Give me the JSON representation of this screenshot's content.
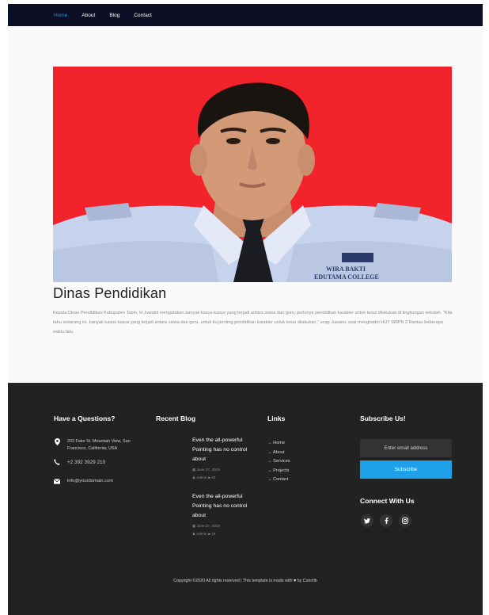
{
  "nav": {
    "items": [
      {
        "label": "Home",
        "active": true
      },
      {
        "label": "About"
      },
      {
        "label": "Blog"
      },
      {
        "label": "Contact"
      }
    ]
  },
  "article": {
    "title": "Dinas Pendidikan",
    "body": "Kepala Dinas Pendidikan Kabupaten Tapin, H Juwaini mengatakan banyak kasus-kasus yang terjadi antara siswa dan guru, perlunya pendidikan karakter untuk terus dilakukan di lingkungan sekolah. \"Kita tahu sekarang ini, banyak kasus-kasus yang terjadi antara siswa dan guru, untuk itu penting pendidikan karakter untuk terus dilakukan,\" ucap Juwaini, saat menghadiri HUT SMPN 2 Rantau beberapa waktu lalu.",
    "photo_badge_line1": "WIRA BAKTI",
    "photo_badge_line2": "EDUTAMA COLLEGE",
    "colors": {
      "photo_bg": "#f3232b",
      "shirt": "#c7d3ec",
      "tie": "#1a1c22"
    }
  },
  "footer": {
    "questions": {
      "heading": "Have a Questions?",
      "address": "203 Fake St. Mountain View, San Francisco, California, USA",
      "phone": "+2 392 3929 210",
      "email": "info@yourdomain.com"
    },
    "blog": {
      "heading": "Recent Blog",
      "posts": [
        {
          "title": "Even the all-powerful Pointing has no control about",
          "date": "June 27, 2019",
          "author": "Admin",
          "comments": "19"
        },
        {
          "title": "Even the all-powerful Pointing has no control about",
          "date": "June 27, 2019",
          "author": "Admin",
          "comments": "19"
        }
      ]
    },
    "links": {
      "heading": "Links",
      "items": [
        "→ Home",
        "→ About",
        "→ Services",
        "→ Projects",
        "→ Contact"
      ]
    },
    "subscribe": {
      "heading": "Subscribe Us!",
      "placeholder": "Enter email address",
      "button": "Subscribe",
      "connect_heading": "Connect With Us",
      "social_icons": [
        "twitter-icon",
        "facebook-icon",
        "instagram-icon"
      ]
    },
    "copyright": "Copyright ©2020 All rights reserved | This template is made with",
    "copyright_by": "by Colorlib"
  },
  "colors": {
    "nav_bg": "#0c0f23",
    "nav_active": "#2e8fd8",
    "footer_bg": "#222222",
    "accent": "#1ea1e9"
  }
}
